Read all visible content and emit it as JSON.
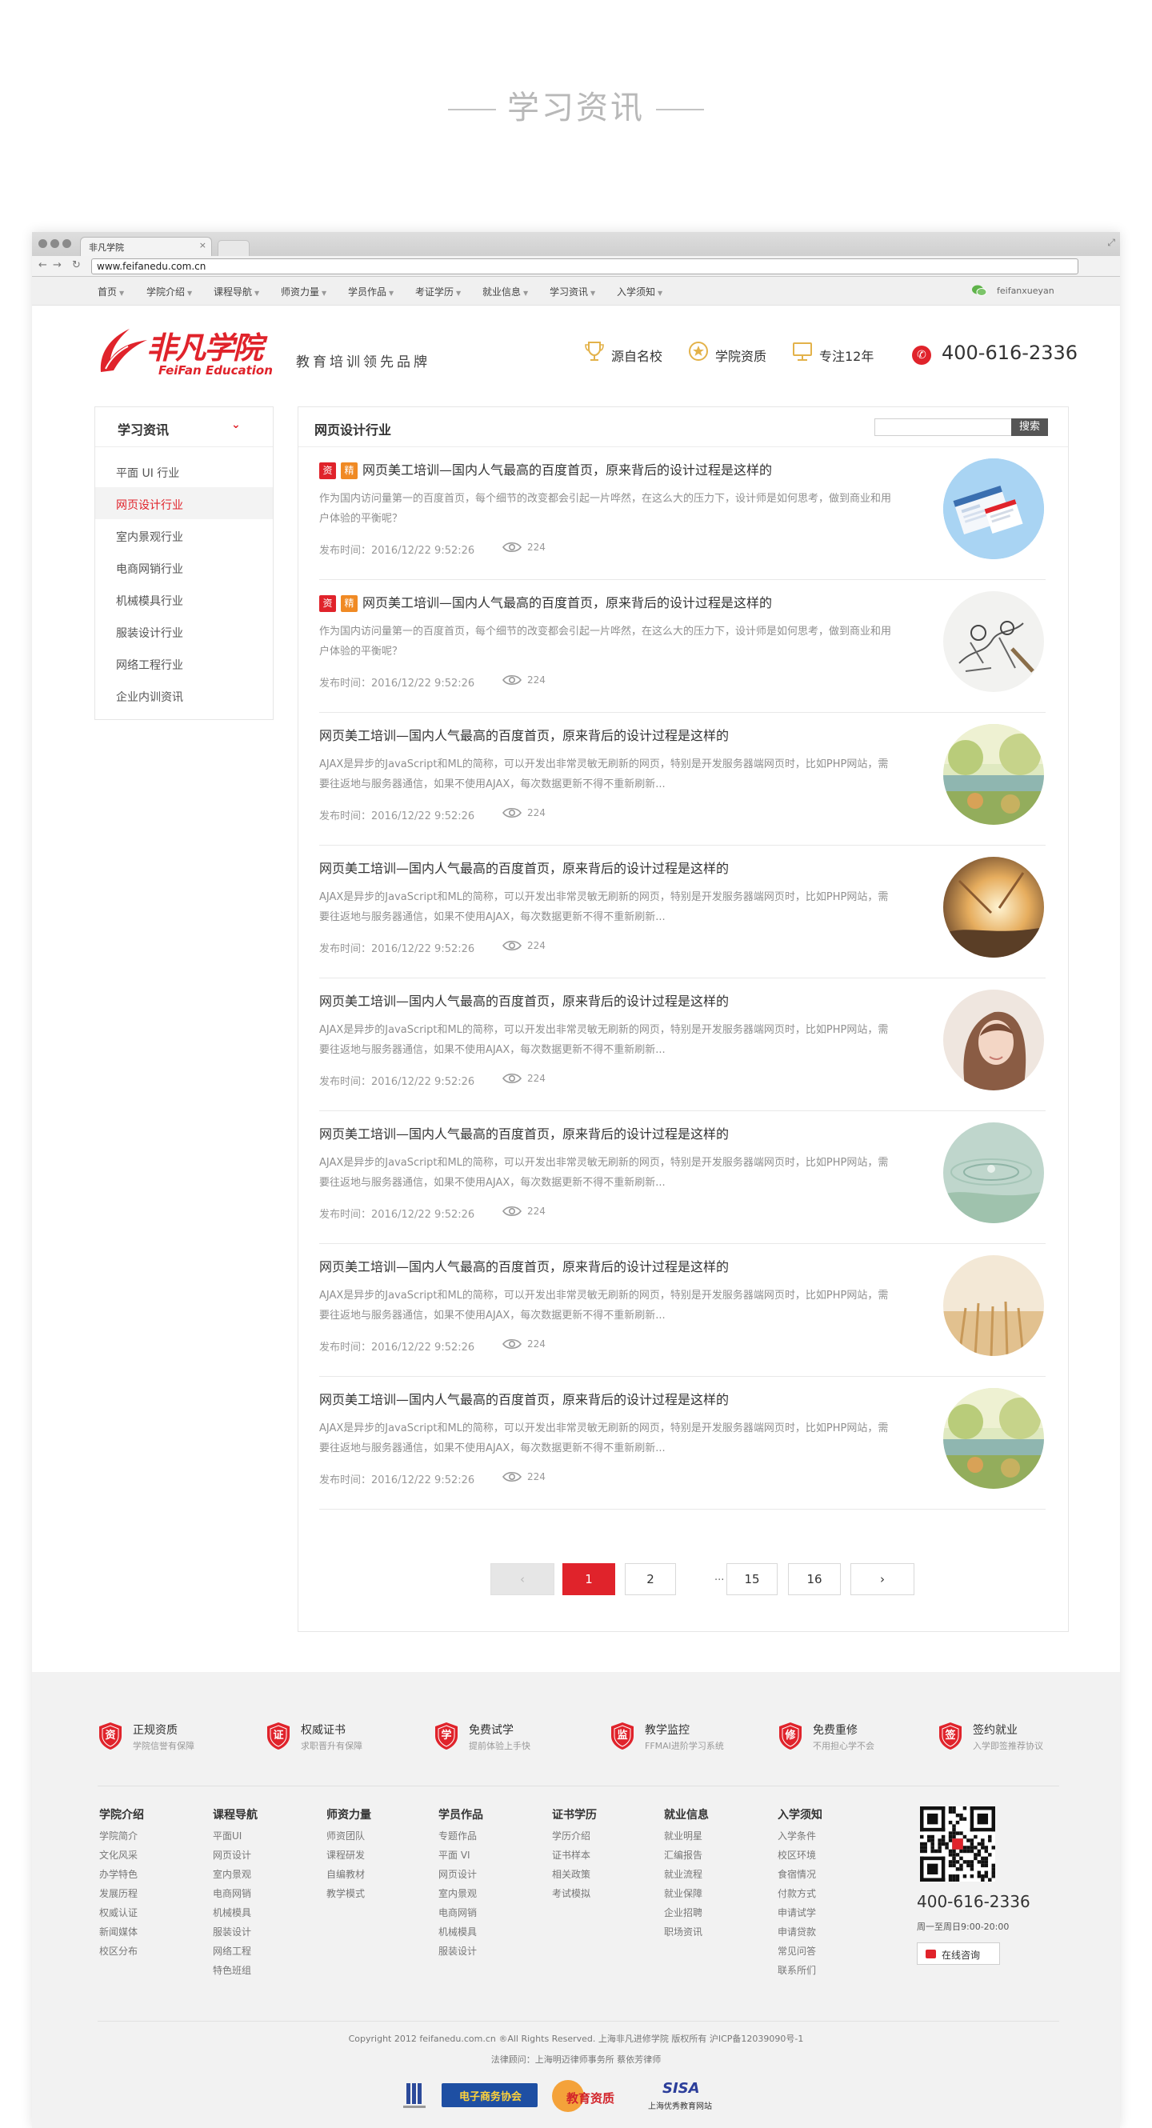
{
  "page_title": "学习资讯",
  "browser": {
    "tab_title": "非凡学院",
    "url": "www.feifanedu.com.cn"
  },
  "topnav": {
    "items": [
      "首页",
      "学院介绍",
      "课程导航",
      "师资力量",
      "学员作品",
      "考证学历",
      "就业信息",
      "学习资讯",
      "入学须知"
    ],
    "wechat": "feifanxueyan"
  },
  "header": {
    "logo_cn": "非凡学院",
    "logo_en": "FeiFan Education",
    "slogan": "教育培训领先品牌",
    "features": [
      "源自名校",
      "学院资质",
      "专注12年"
    ],
    "phone": "400-616-2336"
  },
  "sidebar": {
    "title": "学习资讯",
    "items": [
      "平面 UI 行业",
      "网页设计行业",
      "室内景观行业",
      "电商网销行业",
      "机械模具行业",
      "服装设计行业",
      "网络工程行业",
      "企业内训资讯"
    ],
    "active_index": 1
  },
  "main": {
    "title": "网页设计行业",
    "search_button": "搜索",
    "badge_zi": "资",
    "badge_jing": "精",
    "articles": [
      {
        "title": "网页美工培训—国内人气最高的百度首页，原来背后的设计过程是这样的",
        "desc": "作为国内访问量第一的百度首页，每个细节的改变都会引起一片哗然，在这么大的压力下，设计师是如何思考，做到商业和用户体验的平衡呢？",
        "date": "发布时间：2016/12/22 9:52:26",
        "views": "224",
        "badges": true,
        "thumb": "web"
      },
      {
        "title": "网页美工培训—国内人气最高的百度首页，原来背后的设计过程是这样的",
        "desc": "作为国内访问量第一的百度首页，每个细节的改变都会引起一片哗然，在这么大的压力下，设计师是如何思考，做到商业和用户体验的平衡呢？",
        "date": "发布时间：2016/12/22 9:52:26",
        "views": "224",
        "badges": true,
        "thumb": "sketch"
      },
      {
        "title": "网页美工培训—国内人气最高的百度首页，原来背后的设计过程是这样的",
        "desc": "AJAX是异步的JavaScript和ML的简称，可以开发出非常灵敏无刷新的网页，特别是开发服务器端网页时，比如PHP网站，需要往返地与服务器通信，如果不使用AJAX，每次数据更新不得不重新刷新...",
        "date": "发布时间：2016/12/22 9:52:26",
        "views": "224",
        "badges": false,
        "thumb": "garden"
      },
      {
        "title": "网页美工培训—国内人气最高的百度首页，原来背后的设计过程是这样的",
        "desc": "AJAX是异步的JavaScript和ML的简称，可以开发出非常灵敏无刷新的网页，特别是开发服务器端网页时，比如PHP网站，需要往返地与服务器通信，如果不使用AJAX，每次数据更新不得不重新刷新...",
        "date": "发布时间：2016/12/22 9:52:26",
        "views": "224",
        "badges": false,
        "thumb": "sunset"
      },
      {
        "title": "网页美工培训—国内人气最高的百度首页，原来背后的设计过程是这样的",
        "desc": "AJAX是异步的JavaScript和ML的简称，可以开发出非常灵敏无刷新的网页，特别是开发服务器端网页时，比如PHP网站，需要往返地与服务器通信，如果不使用AJAX，每次数据更新不得不重新刷新...",
        "date": "发布时间：2016/12/22 9:52:26",
        "views": "224",
        "badges": false,
        "thumb": "girl"
      },
      {
        "title": "网页美工培训—国内人气最高的百度首页，原来背后的设计过程是这样的",
        "desc": "AJAX是异步的JavaScript和ML的简称，可以开发出非常灵敏无刷新的网页，特别是开发服务器端网页时，比如PHP网站，需要往返地与服务器通信，如果不使用AJAX，每次数据更新不得不重新刷新...",
        "date": "发布时间：2016/12/22 9:52:26",
        "views": "224",
        "badges": false,
        "thumb": "water"
      },
      {
        "title": "网页美工培训—国内人气最高的百度首页，原来背后的设计过程是这样的",
        "desc": "AJAX是异步的JavaScript和ML的简称，可以开发出非常灵敏无刷新的网页，特别是开发服务器端网页时，比如PHP网站，需要往返地与服务器通信，如果不使用AJAX，每次数据更新不得不重新刷新...",
        "date": "发布时间：2016/12/22 9:52:26",
        "views": "224",
        "badges": false,
        "thumb": "wheat"
      },
      {
        "title": "网页美工培训—国内人气最高的百度首页，原来背后的设计过程是这样的",
        "desc": "AJAX是异步的JavaScript和ML的简称，可以开发出非常灵敏无刷新的网页，特别是开发服务器端网页时，比如PHP网站，需要往返地与服务器通信，如果不使用AJAX，每次数据更新不得不重新刷新...",
        "date": "发布时间：2016/12/22 9:52:26",
        "views": "224",
        "badges": false,
        "thumb": "garden"
      }
    ],
    "pagination": {
      "prev": "‹",
      "pages": [
        "1",
        "2",
        "15",
        "16"
      ],
      "ellipsis": "...",
      "next": "›",
      "current": "1"
    }
  },
  "footer": {
    "features": [
      {
        "icon": "资",
        "title": "正规资质",
        "sub": "学院信誉有保障"
      },
      {
        "icon": "证",
        "title": "权威证书",
        "sub": "求职晋升有保障"
      },
      {
        "icon": "学",
        "title": "免费试学",
        "sub": "提前体验上手快"
      },
      {
        "icon": "监",
        "title": "教学监控",
        "sub": "FFMAI进阶学习系统"
      },
      {
        "icon": "修",
        "title": "免费重修",
        "sub": "不用担心学不会"
      },
      {
        "icon": "签",
        "title": "签约就业",
        "sub": "入学即签推荐协议"
      }
    ],
    "columns": [
      {
        "head": "学院介绍",
        "links": [
          "学院简介",
          "文化风采",
          "办学特色",
          "发展历程",
          "权威认证",
          "新闻媒体",
          "校区分布"
        ]
      },
      {
        "head": "课程导航",
        "links": [
          "平面UI",
          "网页设计",
          "室内景观",
          "电商网销",
          "机械模具",
          "服装设计",
          "网络工程",
          "特色班组"
        ]
      },
      {
        "head": "师资力量",
        "links": [
          "师资团队",
          "课程研发",
          "自编教材",
          "教学模式"
        ]
      },
      {
        "head": "学员作品",
        "links": [
          "专题作品",
          "平面 VI",
          "网页设计",
          "室内景观",
          "电商网销",
          "机械模具",
          "服装设计"
        ]
      },
      {
        "head": "证书学历",
        "links": [
          "学历介绍",
          "证书样本",
          "相关政策",
          "考试模拟"
        ]
      },
      {
        "head": "就业信息",
        "links": [
          "就业明星",
          "汇编报告",
          "就业流程",
          "就业保障",
          "企业招聘",
          "职场资讯"
        ]
      },
      {
        "head": "入学须知",
        "links": [
          "入学条件",
          "校区环境",
          "食宿情况",
          "付款方式",
          "申请试学",
          "申请贷款",
          "常见问答",
          "联系所们"
        ]
      }
    ],
    "phone": "400-616-2336",
    "hours": "周一至周日9:00-20:00",
    "consult": "在线咨询",
    "copyright": "Copyright 2012 feifanedu.com.cn ®All Rights Reserved. 上海非凡进修学院 版权所有 沪ICP备12039090号-1",
    "legal": "法律顾问：上海明迈律师事务所 蔡依芳律师",
    "certs": [
      "电子商务协会",
      "教育资质",
      "SISA",
      "上海优秀教育网站"
    ]
  },
  "colors": {
    "accent": "#e0232b",
    "footer_bg": "#f2f2f2"
  }
}
